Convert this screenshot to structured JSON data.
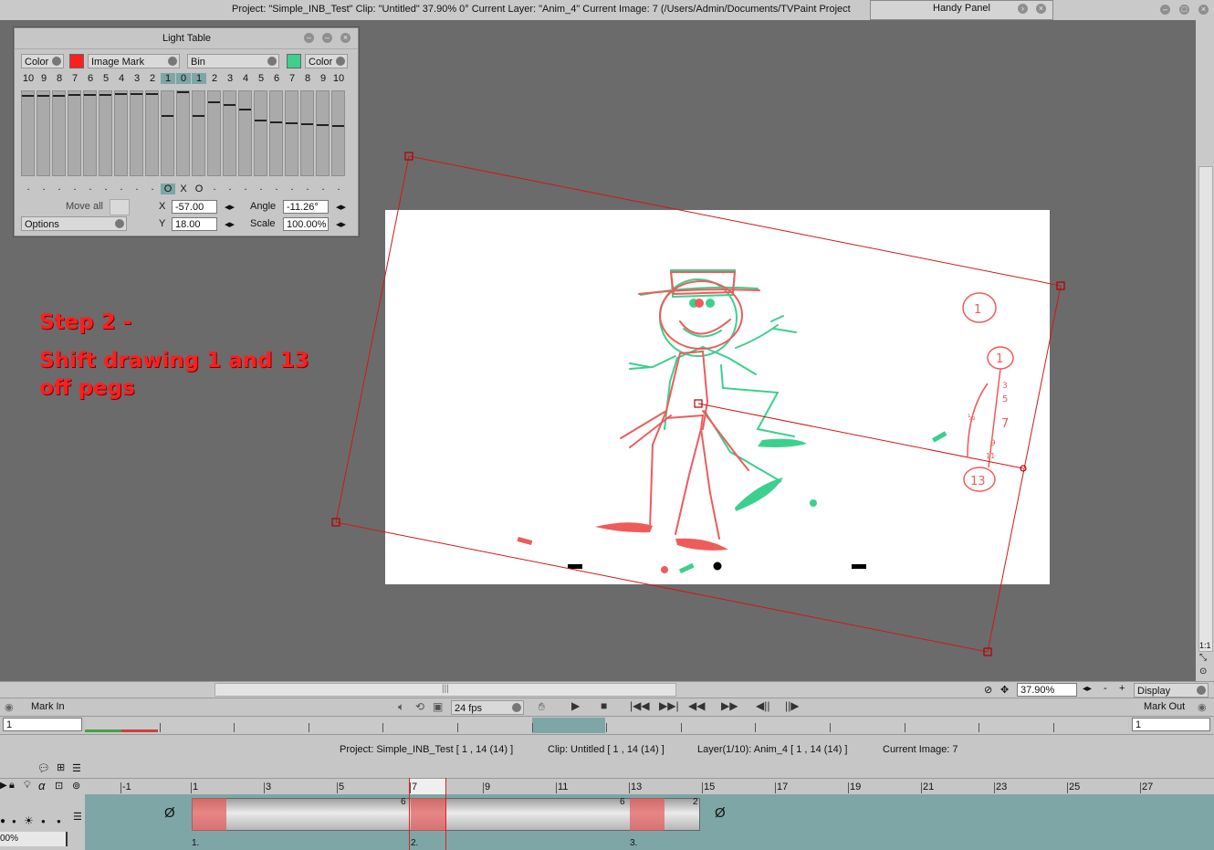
{
  "titlebar": {
    "text": "Project:  \"Simple_INB_Test\"  Clip: \"Untitled\"   37.90%   0°  Current Layer: \"Anim_4\"  Current Image: 7 (/Users/Admin/Documents/TVPaint Project",
    "handy_panel": "Handy Panel"
  },
  "light_table": {
    "title": "Light Table",
    "left_color": "Color",
    "left_swatch": "#ff1f1f",
    "mode": "Image Mark",
    "bin": "Bin",
    "right_swatch": "#3ccf8e",
    "right_color": "Color",
    "numbers_left": [
      "10",
      "9",
      "8",
      "7",
      "6",
      "5",
      "4",
      "3",
      "2",
      "1"
    ],
    "center": "0",
    "numbers_right": [
      "1",
      "2",
      "3",
      "4",
      "5",
      "6",
      "7",
      "8",
      "9",
      "10"
    ],
    "markers": [
      "O",
      "X",
      "O"
    ],
    "move_all": "Move all",
    "options": "Options",
    "x_label": "X",
    "x_value": "-57.00",
    "y_label": "Y",
    "y_value": "18.00",
    "angle_label": "Angle",
    "angle_value": "-11.26°",
    "scale_label": "Scale",
    "scale_value": "100.00%"
  },
  "annotation": {
    "title": "Step 2 -",
    "desc": "Shift drawing 1 and 13 off pegs"
  },
  "canvas_marks": {
    "circle_top": "1",
    "chart_top": "1",
    "chart_3": "3",
    "chart_5": "5",
    "chart_half": "½",
    "chart_7": "7",
    "chart_9": "9",
    "chart_11": "11",
    "chart_13": "13"
  },
  "view": {
    "zoom": "37.90%",
    "display": "Display"
  },
  "playbar": {
    "mark_in": "Mark In",
    "fps": "24 fps",
    "mark_out": "Mark Out",
    "mark_in_value": "1",
    "mark_out_value": "1"
  },
  "info": {
    "project": "Project: Simple_INB_Test [ 1 , 14  (14) ]",
    "clip": "Clip: Untitled [ 1 , 14  (14) ]",
    "layer": "Layer(1/10): Anim_4 [ 1 , 14  (14) ]",
    "current": "Current Image: 7"
  },
  "timeline": {
    "ruler": [
      "1",
      "1",
      "3",
      "5",
      "7",
      "9",
      "11",
      "13",
      "15",
      "17",
      "19",
      "21",
      "23",
      "25",
      "27"
    ],
    "current_frame": "7",
    "opacity": "00%",
    "instance_labels": [
      "1.",
      "2.",
      "3."
    ],
    "instance_counts": [
      "6",
      "6",
      "2"
    ],
    "empty_symbol": "Ø"
  }
}
